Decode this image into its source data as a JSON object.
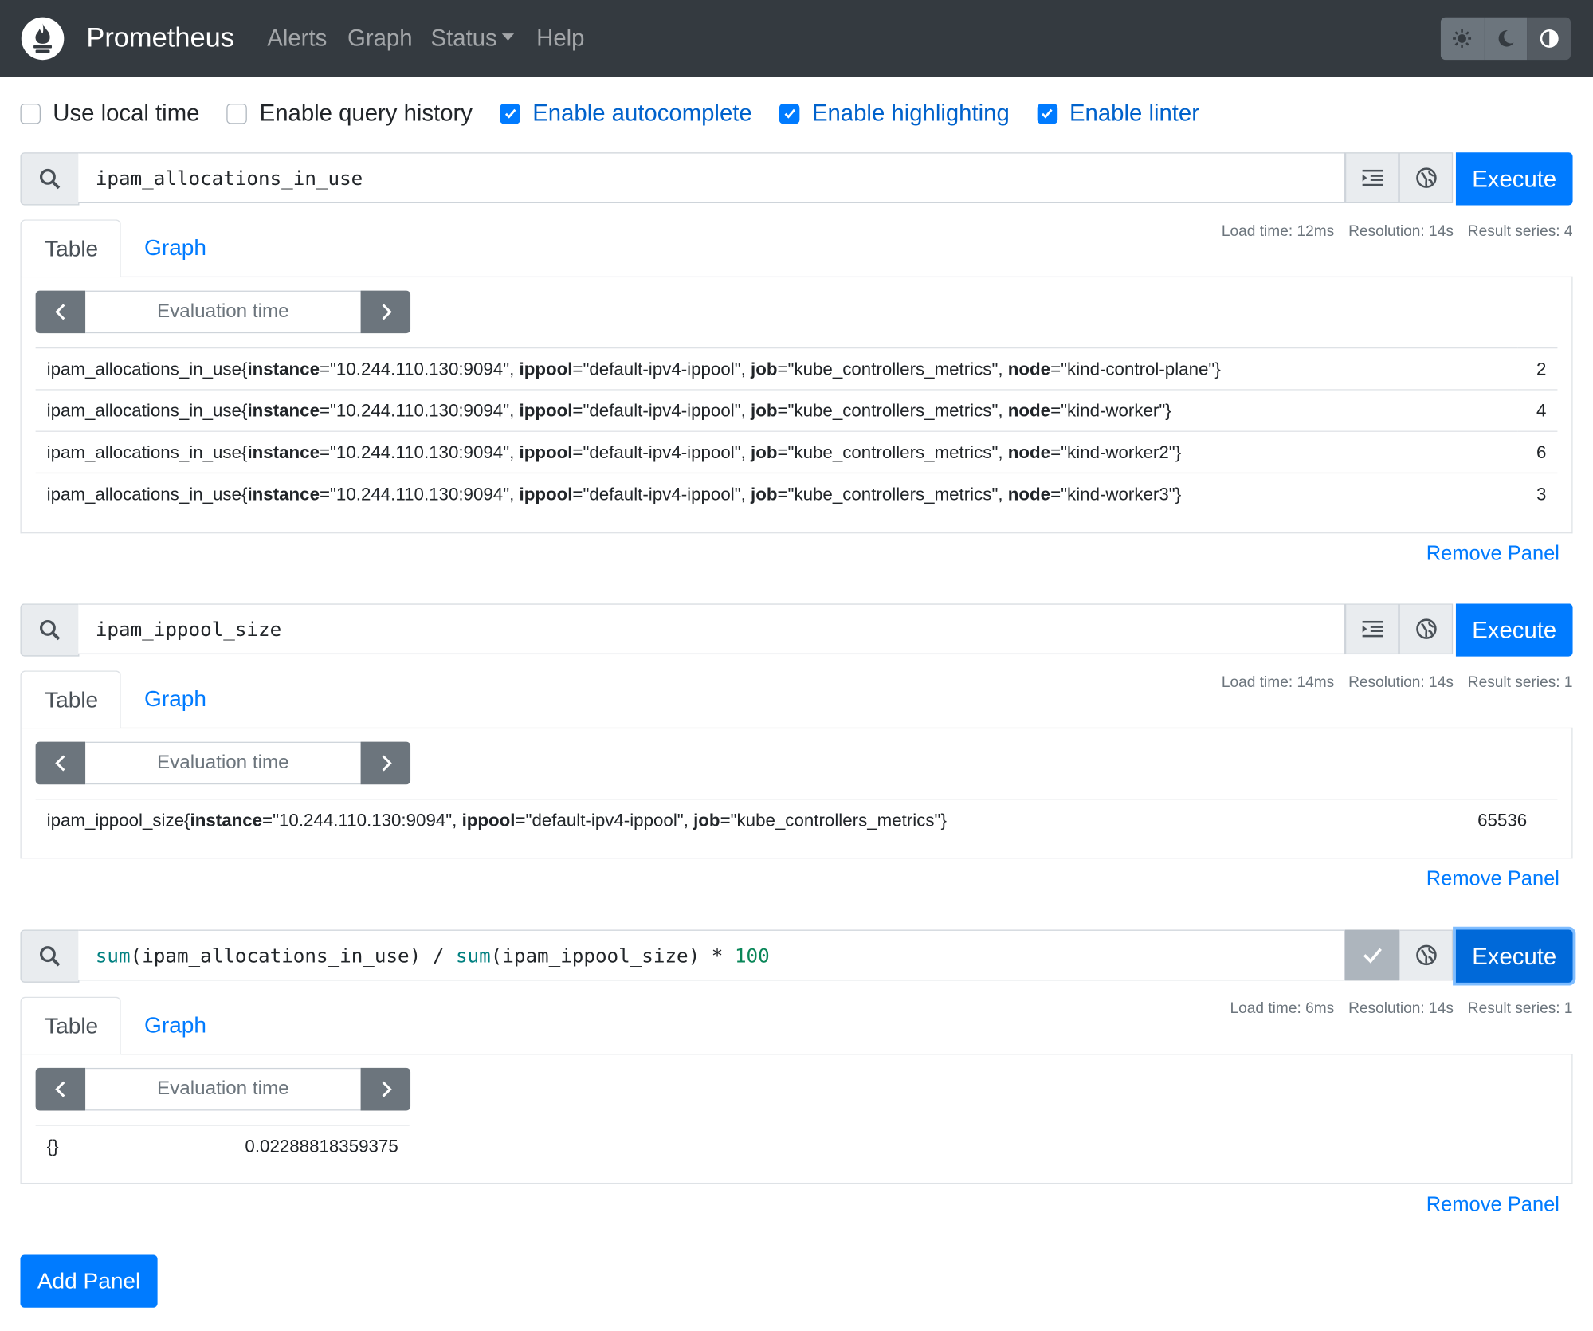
{
  "navbar": {
    "brand": "Prometheus",
    "links": [
      "Alerts",
      "Graph",
      "Status",
      "Help"
    ],
    "theme_icons": [
      "sun-icon",
      "moon-icon",
      "contrast-icon"
    ]
  },
  "options": [
    {
      "label": "Use local time",
      "checked": false
    },
    {
      "label": "Enable query history",
      "checked": false
    },
    {
      "label": "Enable autocomplete",
      "checked": true
    },
    {
      "label": "Enable highlighting",
      "checked": true
    },
    {
      "label": "Enable linter",
      "checked": true
    }
  ],
  "common": {
    "execute": "Execute",
    "tab_table": "Table",
    "tab_graph": "Graph",
    "eval_placeholder": "Evaluation time",
    "remove_panel": "Remove Panel",
    "add_panel": "Add Panel"
  },
  "panels": [
    {
      "query": "ipam_allocations_in_use",
      "stats": {
        "load": "Load time: 12ms",
        "resolution": "Resolution: 14s",
        "series": "Result series: 4"
      },
      "rows": [
        {
          "metric": "ipam_allocations_in_use",
          "labels": [
            [
              "instance",
              "10.244.110.130:9094"
            ],
            [
              "ippool",
              "default-ipv4-ippool"
            ],
            [
              "job",
              "kube_controllers_metrics"
            ],
            [
              "node",
              "kind-control-plane"
            ]
          ],
          "value": "2"
        },
        {
          "metric": "ipam_allocations_in_use",
          "labels": [
            [
              "instance",
              "10.244.110.130:9094"
            ],
            [
              "ippool",
              "default-ipv4-ippool"
            ],
            [
              "job",
              "kube_controllers_metrics"
            ],
            [
              "node",
              "kind-worker"
            ]
          ],
          "value": "4"
        },
        {
          "metric": "ipam_allocations_in_use",
          "labels": [
            [
              "instance",
              "10.244.110.130:9094"
            ],
            [
              "ippool",
              "default-ipv4-ippool"
            ],
            [
              "job",
              "kube_controllers_metrics"
            ],
            [
              "node",
              "kind-worker2"
            ]
          ],
          "value": "6"
        },
        {
          "metric": "ipam_allocations_in_use",
          "labels": [
            [
              "instance",
              "10.244.110.130:9094"
            ],
            [
              "ippool",
              "default-ipv4-ippool"
            ],
            [
              "job",
              "kube_controllers_metrics"
            ],
            [
              "node",
              "kind-worker3"
            ]
          ],
          "value": "3"
        }
      ]
    },
    {
      "query": "ipam_ippool_size",
      "stats": {
        "load": "Load time: 14ms",
        "resolution": "Resolution: 14s",
        "series": "Result series: 1"
      },
      "rows": [
        {
          "metric": "ipam_ippool_size",
          "labels": [
            [
              "instance",
              "10.244.110.130:9094"
            ],
            [
              "ippool",
              "default-ipv4-ippool"
            ],
            [
              "job",
              "kube_controllers_metrics"
            ]
          ],
          "value": "65536"
        }
      ]
    },
    {
      "query": "sum(ipam_allocations_in_use) / sum(ipam_ippool_size) * 100",
      "stats": {
        "load": "Load time: 6ms",
        "resolution": "Resolution: 14s",
        "series": "Result series: 1"
      },
      "rows": [
        {
          "metric": "",
          "labels": [],
          "value": "0.02288818359375",
          "raw": "{}"
        }
      ]
    }
  ]
}
